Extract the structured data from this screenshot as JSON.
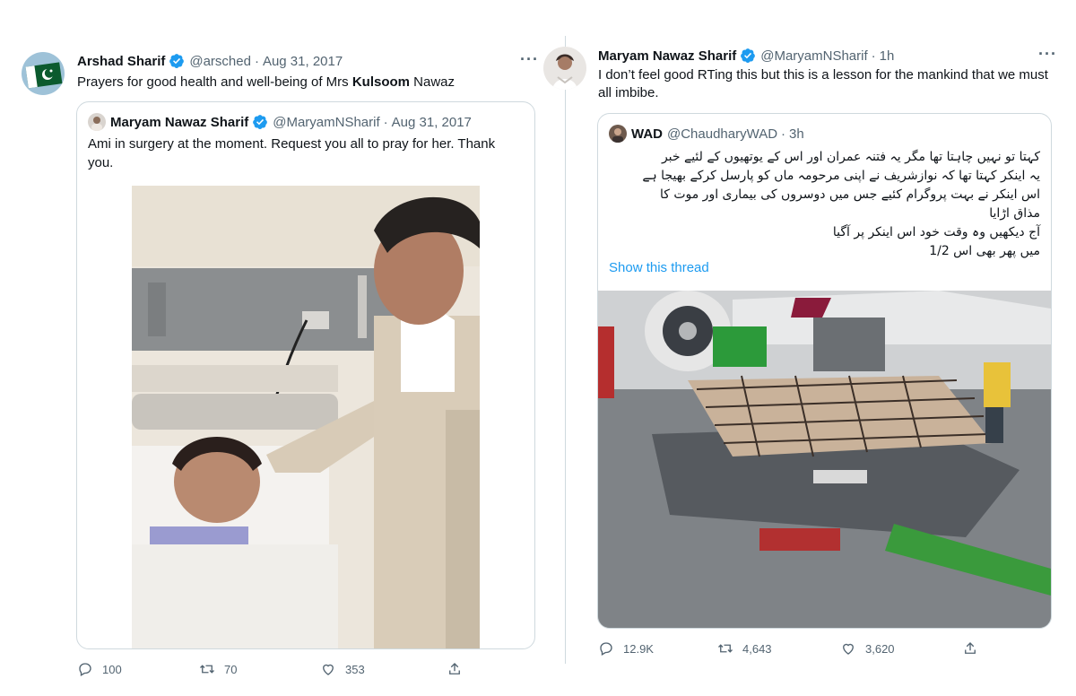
{
  "left": {
    "author_name": "Arshad Sharif",
    "handle": "@arsched",
    "separator": "·",
    "time": "Aug 31, 2017",
    "more": "···",
    "text_before": "Prayers for good health and well-being of Mrs ",
    "text_bold": "Kulsoom",
    "text_after": " Nawaz",
    "quote": {
      "author_name": "Maryam Nawaz Sharif",
      "handle": "@MaryamNSharif",
      "separator": "·",
      "time": "Aug 31, 2017",
      "text": "Ami in surgery at the moment. Request you all to pray for her. Thank you."
    },
    "stats": {
      "replies": "100",
      "retweets": "70",
      "likes": "353"
    }
  },
  "right": {
    "author_name": "Maryam Nawaz Sharif",
    "handle": "@MaryamNSharif",
    "separator": "·",
    "time": "1h",
    "more": "···",
    "text": "I don’t feel good RTing this but this is a lesson for the mankind that we must all imbibe.",
    "quote": {
      "author_name": "WAD",
      "handle": "@ChaudharyWAD",
      "separator": "·",
      "time": "3h",
      "lines": [
        "کہتا تو نہیں چاہتا تھا  مگر یہ فتنہ عمران اور اس کے یوتھیوں کے لئیے خبر",
        "یہ اینکر کہتا تھا کہ نوازشریف نے اپنی مرحومہ ماں کو پارسل کرکے بھیجا ہے",
        "اس اینکر نے بہت پروگرام کئیے جس میں دوسروں کی بیماری اور موت کا",
        "مذاق اڑایا",
        "آج دیکھیں  وہ وقت خود اس اینکر پر آگیا",
        "میں پھر بھی اس 1/2"
      ],
      "show_thread": "Show this thread"
    },
    "stats": {
      "replies": "12.9K",
      "retweets": "4,643",
      "likes": "3,620"
    }
  },
  "colors": {
    "verified": "#1d9bf0",
    "link": "#1d9bf0",
    "muted": "#536471",
    "border": "#cfd9de"
  },
  "icons": [
    "verified-badge-icon",
    "reply-icon",
    "retweet-icon",
    "like-icon",
    "share-icon",
    "more-icon"
  ]
}
